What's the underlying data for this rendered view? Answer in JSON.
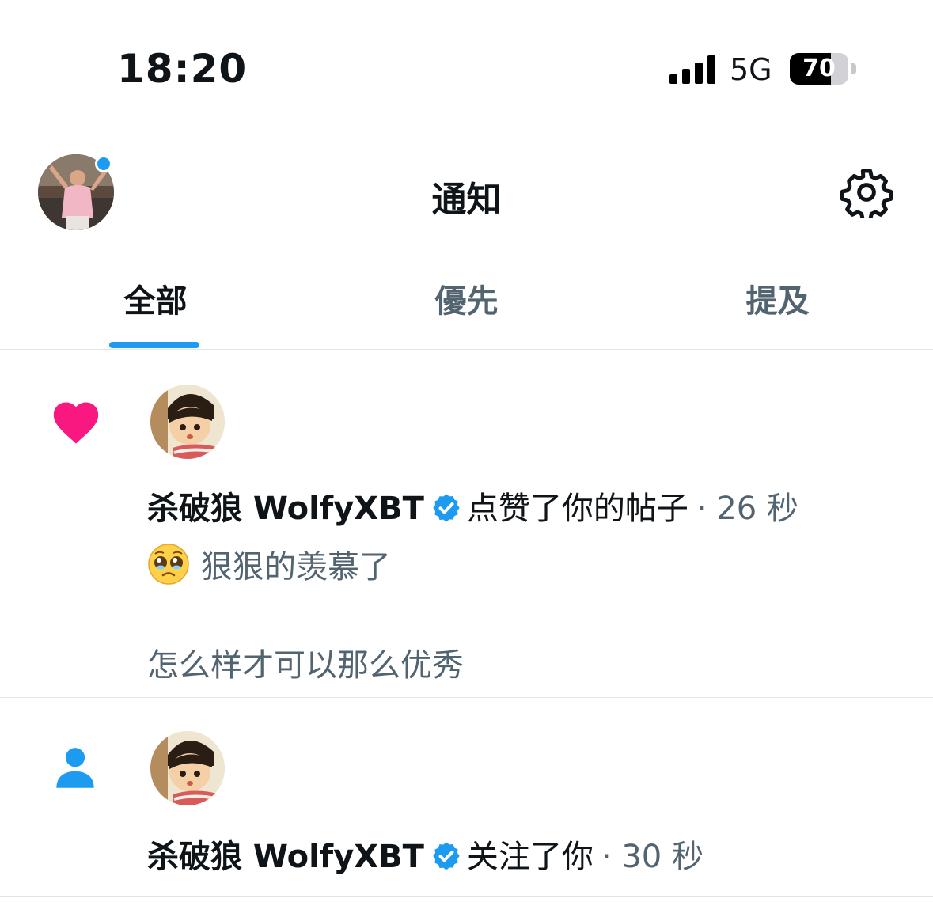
{
  "status_bar": {
    "time": "18:20",
    "network": "5G",
    "battery": "70",
    "battery_level": 0.7,
    "icons": [
      "signal-icon",
      "battery-icon"
    ]
  },
  "header": {
    "title": "通知",
    "icons": [
      "avatar",
      "gear-icon"
    ],
    "colors": {
      "accent": "#1d9bf0"
    }
  },
  "tabs": [
    {
      "label": "全部",
      "active": true
    },
    {
      "label": "優先",
      "active": false
    },
    {
      "label": "提及",
      "active": false
    }
  ],
  "notifications": [
    {
      "type": "like",
      "icon": "heart-icon",
      "icon_color": "#f91880",
      "username": "杀破狼 WolfyXBT",
      "verified": true,
      "action": "点赞了你的帖子",
      "time": "· 26 秒",
      "emoji": "pleading-face-emoji",
      "snippet_line1": "狠狠的羡慕了",
      "snippet_line2": "怎么样才可以那么优秀"
    },
    {
      "type": "follow",
      "icon": "person-icon",
      "icon_color": "#1d9bf0",
      "username": "杀破狼 WolfyXBT",
      "verified": true,
      "action": "关注了你",
      "time": "· 30 秒"
    }
  ]
}
